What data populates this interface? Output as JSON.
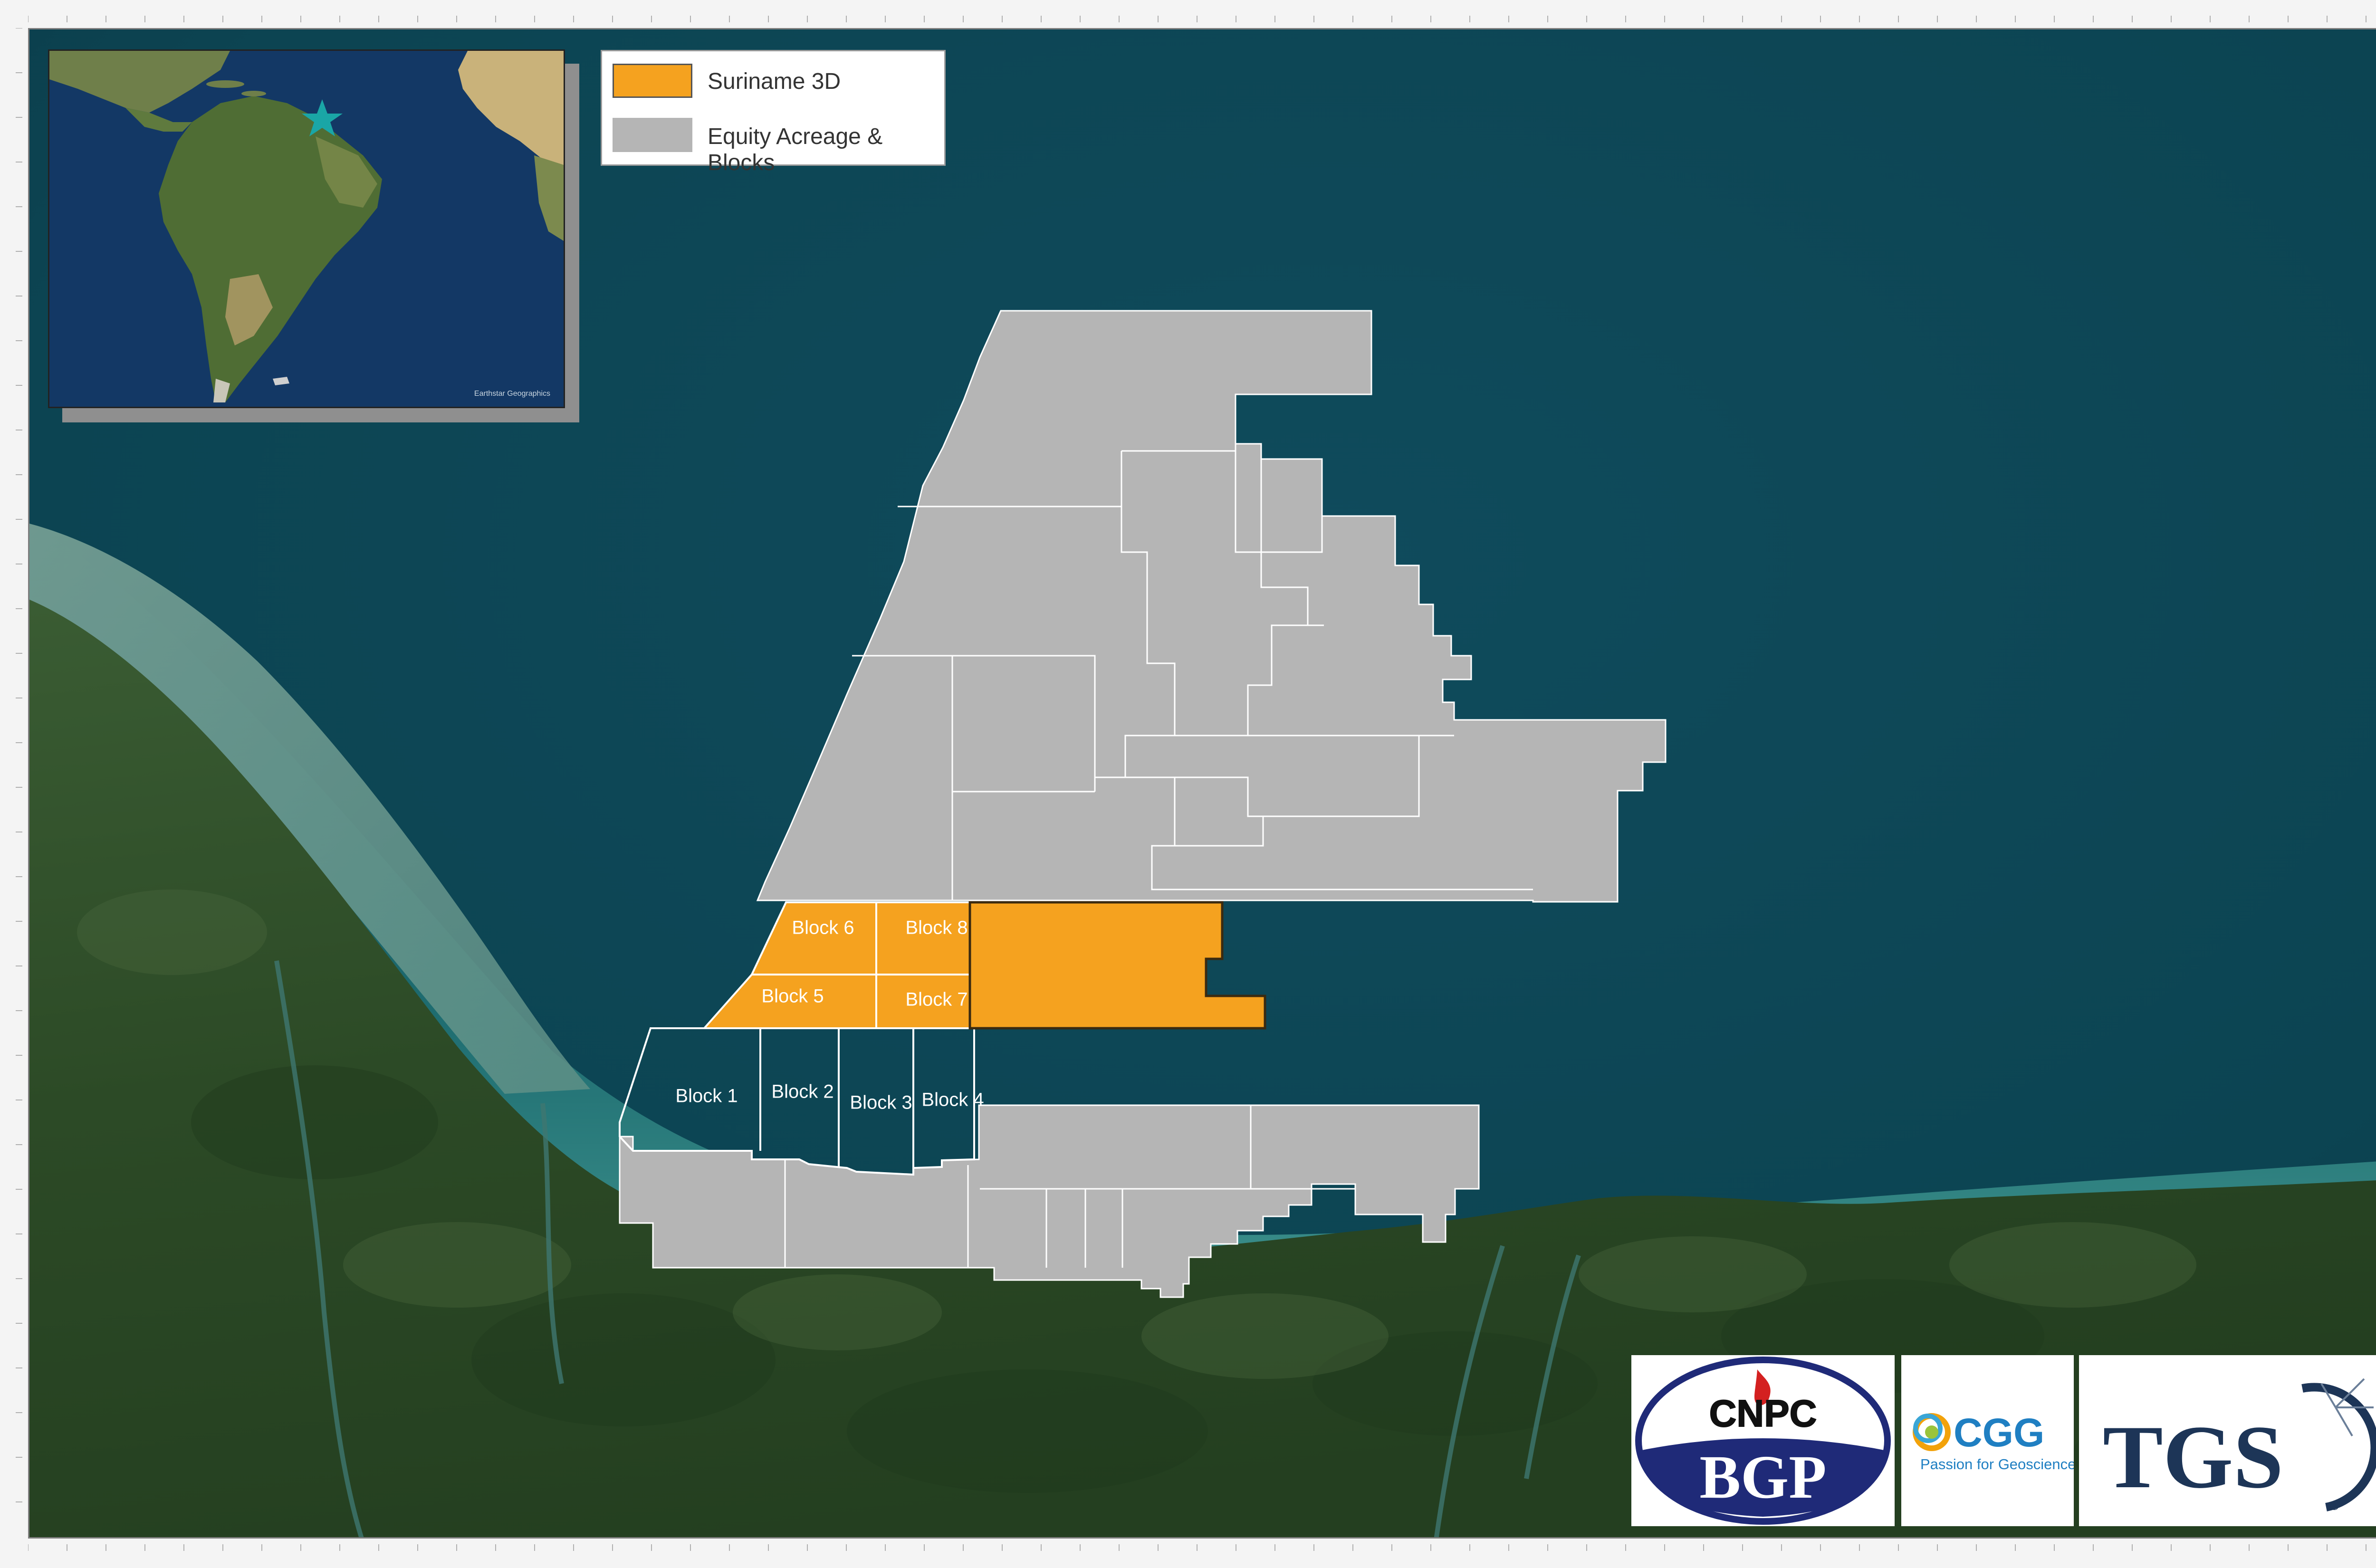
{
  "legend": {
    "items": [
      {
        "label": "Suriname 3D",
        "color": "#f5a21f"
      },
      {
        "label": "Equity Acreage & Blocks",
        "color": "#b5b5b5"
      }
    ]
  },
  "blocks": [
    {
      "label": "Block 1"
    },
    {
      "label": "Block 2"
    },
    {
      "label": "Block 3"
    },
    {
      "label": "Block 4"
    },
    {
      "label": "Block 5"
    },
    {
      "label": "Block 6"
    },
    {
      "label": "Block 7"
    },
    {
      "label": "Block 8"
    }
  ],
  "inset": {
    "credit": "Earthstar Geographics",
    "marker_icon": "star-icon",
    "marker_color": "#1aa6a6"
  },
  "logos": {
    "cnpc": {
      "top_text": "CNPC",
      "bottom_text": "BGP"
    },
    "cgg": {
      "name": "CGG",
      "tagline": "Passion for Geoscience"
    },
    "tgs": {
      "name": "TGS",
      "mark": "®"
    }
  },
  "colors": {
    "ocean": "#0d4a5a",
    "land": "#2c4a26",
    "survey": "#f5a21f",
    "acreage": "#b5b5b5",
    "block_edge": "#ffffff",
    "logo_navy": "#1f2a78",
    "tgs_navy": "#1d3557"
  }
}
